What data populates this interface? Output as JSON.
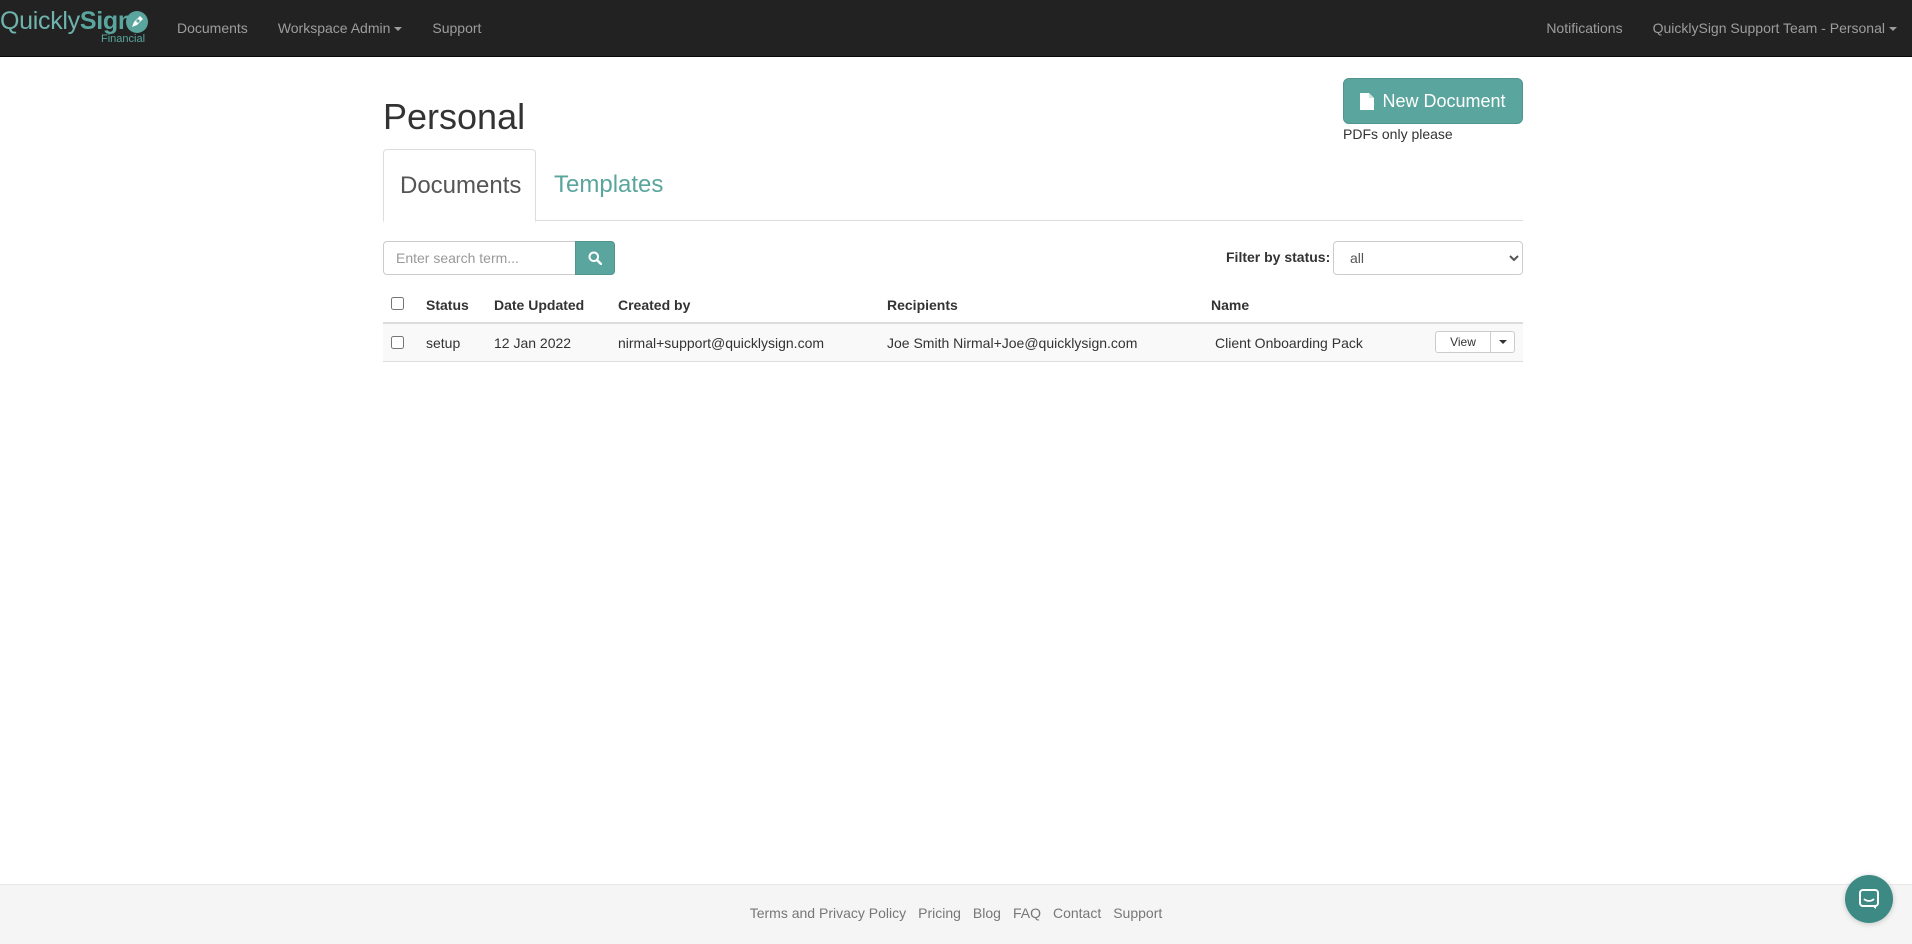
{
  "brand": {
    "name_light": "Quickly",
    "name_bold": "Sign",
    "sub": "Financial"
  },
  "nav": {
    "left": [
      "Documents",
      "Workspace Admin",
      "Support"
    ],
    "right": [
      "Notifications",
      "QuicklySign Support Team - Personal"
    ]
  },
  "page": {
    "title": "Personal",
    "new_document_label": "New Document",
    "pdf_hint": "PDFs only please"
  },
  "tabs": [
    {
      "label": "Documents",
      "active": true
    },
    {
      "label": "Templates",
      "active": false
    }
  ],
  "search": {
    "placeholder": "Enter search term..."
  },
  "filter": {
    "label": "Filter by status:",
    "selected": "all"
  },
  "table": {
    "headers": [
      "Status",
      "Date Updated",
      "Created by",
      "Recipients",
      "Name"
    ],
    "rows": [
      {
        "status": "setup",
        "date_updated": "12 Jan 2022",
        "created_by": "nirmal+support@quicklysign.com",
        "recipients": "Joe Smith Nirmal+Joe@quicklysign.com",
        "name": "Client Onboarding Pack",
        "action_label": "View"
      }
    ]
  },
  "footer": {
    "links": [
      "Terms and Privacy Policy",
      "Pricing",
      "Blog",
      "FAQ",
      "Contact",
      "Support"
    ]
  },
  "colors": {
    "brand": "#5aa59d",
    "navbar": "#222222",
    "chat": "#3d8a84"
  }
}
